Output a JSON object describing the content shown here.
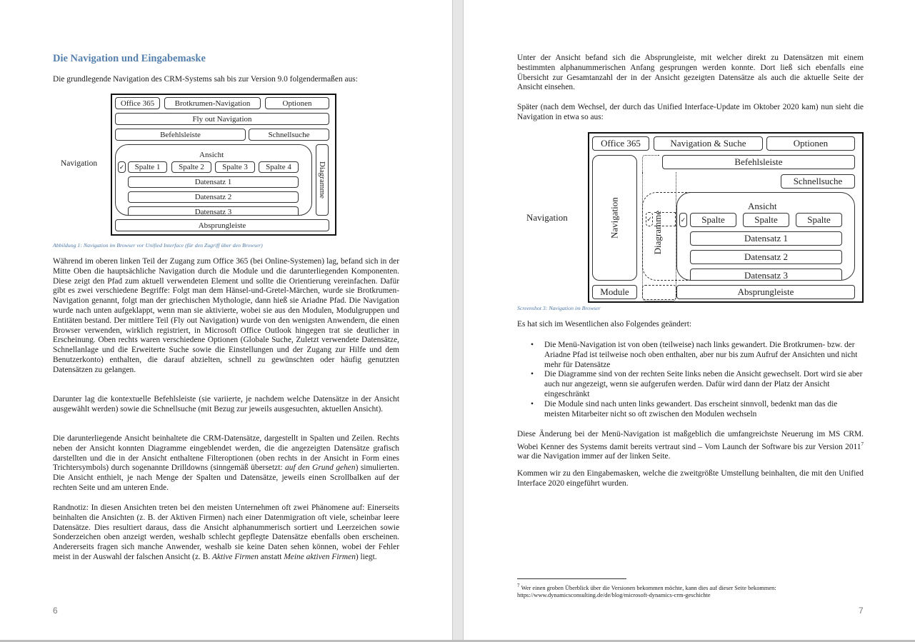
{
  "left_page": {
    "heading": "Die Navigation und Eingabemaske",
    "intro": "Die grundlegende Navigation des CRM-Systems sah bis zur Version 9.0 folgendermaßen aus:",
    "figure1": {
      "side_label": "Navigation",
      "office": "Office 365",
      "breadcrumb": "Brotkrumen-Navigation",
      "options": "Optionen",
      "flyout": "Fly out Navigation",
      "commandbar": "Befehlsleiste",
      "quicksearch": "Schnellsuche",
      "view": "Ansicht",
      "checkbox": "✓",
      "columns": [
        "Spalte 1",
        "Spalte 2",
        "Spalte 3",
        "Spalte 4"
      ],
      "records": [
        "Datensatz 1",
        "Datensatz 2",
        "Datensatz 3"
      ],
      "charts": "Diagramme",
      "jumpbar": "Absprungleiste"
    },
    "caption": "Abbildung 1: Navigation im Browser vor Unified Interface (für den Zugriff über den Browser)",
    "para1": "Während im oberen linken Teil der Zugang zum Office 365 (bei Online-Systemen) lag, befand sich in der Mitte Oben die hauptsächliche Navigation durch die Module und die darunterliegenden Komponenten. Diese zeigt den Pfad zum aktuell verwendeten Element und sollte die Orientierung vereinfachen. Dafür gibt es zwei verschiedene Begriffe: Folgt man dem Hänsel-und-Gretel-Märchen, wurde sie Brotkrumen-Navigation genannt, folgt man der griechischen Mythologie, dann hieß sie Ariadne Pfad. Die Navigation wurde nach unten aufgeklappt, wenn man sie aktivierte, wobei sie aus den Modulen, Modulgruppen und Entitäten bestand. Der mittlere Teil (Fly out Navigation) wurde von den wenigsten Anwendern, die einen Browser verwenden, wirklich registriert, in Microsoft Office Outlook hingegen trat sie deutlicher in Erscheinung. Oben rechts waren verschiedene Optionen (Globale Suche, Zuletzt verwendete Datensätze, Schnellanlage und die Erweiterte Suche sowie die Einstellungen und der Zugang zur Hilfe und dem Benutzerkonto) enthalten, die darauf abzielten, schnell zu gewünschten oder häufig genutzten Datensätzen zu gelangen.",
    "para2": "Darunter lag die kontextuelle Befehlsleiste (sie variierte, je nachdem welche Datensätze in der Ansicht ausgewählt werden) sowie die Schnellsuche (mit Bezug zur jeweils ausgesuchten, aktuellen Ansicht).",
    "para3_a": "Die darunterliegende Ansicht beinhaltete die CRM-Datensätze, dargestellt in Spalten und Zeilen. Rechts neben der Ansicht konnten Diagramme eingeblendet werden, die die angezeigten Datensätze grafisch darstellten und die in der Ansicht enthaltene Filteroptionen (oben rechts in der Ansicht in Form eines Trichtersymbols) durch sogenannte Drilldowns (sinngemäß übersetzt: ",
    "para3_italic": "auf den Grund gehen",
    "para3_b": ") simulierten. Die Ansicht enthielt, je nach Menge der Spalten und Datensätze, jeweils einen Scrollbalken auf der rechten Seite und am unteren Ende.",
    "para4_a": "Randnotiz: In diesen Ansichten treten bei den meisten Unternehmen oft zwei Phänomene auf: Einerseits beinhalten die Ansichten (z. B. der Aktiven Firmen) nach einer Datenmigration oft viele, scheinbar leere Datensätze. Dies resultiert daraus, dass die Ansicht alphanummerisch sortiert und Leerzeichen sowie Sonderzeichen oben anzeigt werden, weshalb schlecht gepflegte Datensätze ebenfalls oben erscheinen. Andererseits fragen sich manche Anwender, weshalb sie keine Daten sehen können, wobei der Fehler meist in der Auswahl der falschen Ansicht (z. B. ",
    "para4_italic1": "Aktive Firmen",
    "para4_b": " anstatt ",
    "para4_italic2": "Meine aktiven Firmen",
    "para4_c": ") liegt.",
    "page_number": "6"
  },
  "right_page": {
    "para1": "Unter der Ansicht befand sich die Absprungleiste, mit welcher direkt zu Datensätzen mit einem bestimmten alphanummerischen Anfang gesprungen werden konnte. Dort ließ sich ebenfalls eine Übersicht zur Gesamtanzahl der in der Ansicht gezeigten Datensätze als auch die aktuelle Seite der Ansicht einsehen.",
    "para2": "Später (nach dem Wechsel, der durch das Unified Interface-Update im Oktober 2020 kam) nun sieht die Navigation in etwa so aus:",
    "figure3": {
      "side_label": "Navigation",
      "office": "Office 365",
      "nav_search": "Navigation & Suche",
      "options": "Optionen",
      "commandbar": "Befehlsleiste",
      "quicksearch": "Schnellsuche",
      "navigation": "Navigation",
      "charts": "Diagramme",
      "view": "Ansicht",
      "checkbox": "✓",
      "columns": [
        "Spalte",
        "Spalte",
        "Spalte"
      ],
      "records": [
        "Datensatz 1",
        "Datensatz 2",
        "Datensatz 3"
      ],
      "modules": "Module",
      "jumpbar": "Absprungleiste"
    },
    "caption": "Screenshot 3: Navigation im Browser",
    "changes_intro": "Es hat sich im Wesentlichen also Folgendes geändert:",
    "bullet_symbol": "•",
    "changes": [
      "Die Menü-Navigation ist von oben (teilweise) nach links gewandert. Die Brotkrumen- bzw. der Ariadne Pfad ist teilweise noch oben enthalten, aber nur bis zum Aufruf der Ansichten und nicht mehr für Datensätze",
      "Die Diagramme sind von der rechten Seite links neben die Ansicht gewechselt. Dort wird sie aber auch nur angezeigt, wenn sie aufgerufen werden. Dafür wird dann der Platz der Ansicht eingeschränkt",
      "Die Module sind nach unten links gewandert. Das erscheint sinnvoll, bedenkt man das die meisten Mitarbeiter nicht so oft zwischen den Modulen wechseln"
    ],
    "para3_a": "Diese Änderung bei der Menü-Navigation ist maßgeblich die umfangreichste Neuerung im MS CRM. Wobei Kenner des Systems damit bereits vertraut sind – Vom Launch der Software bis zur Version 2011",
    "para3_sup": "7",
    "para3_b": " war die Navigation immer auf der linken Seite.",
    "para4": "Kommen wir zu den Eingabemasken, welche die zweitgrößte Umstellung beinhalten, die mit den Unified Interface 2020 eingeführt wurden.",
    "footnote_number": "7",
    "footnote_text": "Wer einen groben Überblick über die Versionen bekommen möchte, kann dies auf dieser Seite bekommen:",
    "footnote_url": "https://www.dynamicsconsulting.de/de/blog/microsoft-dynamics-crm-geschichte",
    "page_number": "7"
  }
}
